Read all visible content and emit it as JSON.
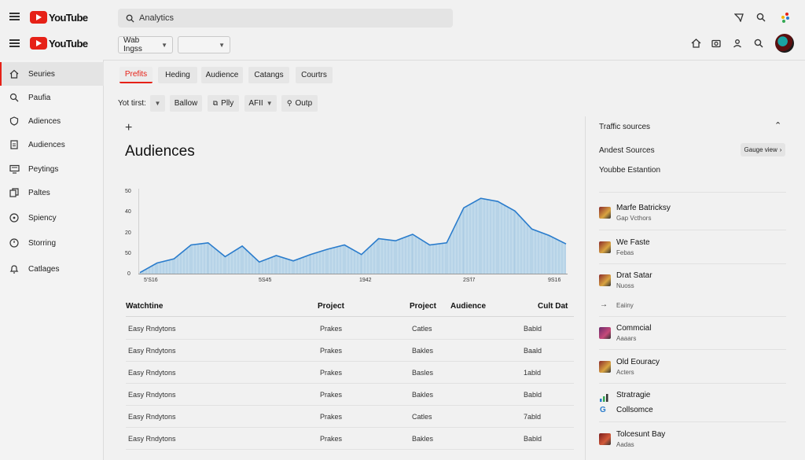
{
  "top_header": {
    "logo_text": "YouTube"
  },
  "header": {
    "logo_text": "YouTube",
    "search_placeholder": "Analytics",
    "filter1": "Wab Ingss",
    "filter2": ""
  },
  "sidebar": {
    "items": [
      {
        "label": "Seuries",
        "icon": "home-icon"
      },
      {
        "label": "Paufia",
        "icon": "search-icon"
      },
      {
        "label": "Adiences",
        "icon": "shield-icon"
      },
      {
        "label": "Audiences",
        "icon": "document-icon"
      },
      {
        "label": "Peytings",
        "icon": "monitor-icon"
      },
      {
        "label": "Paltes",
        "icon": "folders-icon"
      },
      {
        "label": "Spiency",
        "icon": "compass-icon"
      },
      {
        "label": "Storring",
        "icon": "clock-icon"
      },
      {
        "label": "Catlages",
        "icon": "bell-icon"
      }
    ]
  },
  "tabs": [
    "Prefits",
    "Heding",
    "Audience",
    "Catangs",
    "Courtrs"
  ],
  "toolbar": {
    "label": "Yot tirst:",
    "buttons": [
      "Ballow",
      "Plly",
      "AFII",
      "Outp"
    ]
  },
  "page_title": "Audiences",
  "add_symbol": "+",
  "chart_data": {
    "type": "area",
    "y_ticks": [
      "50",
      "40",
      "20",
      "50",
      "0"
    ],
    "x_labels": [
      "5'S16",
      "5S45",
      "1942",
      "2S'l7",
      "9S16"
    ],
    "values": [
      1,
      10,
      14,
      27,
      29,
      16,
      26,
      11,
      17,
      12,
      18,
      23,
      27,
      18,
      33,
      31,
      37,
      27,
      29,
      62,
      71,
      68,
      59,
      42,
      36,
      28
    ]
  },
  "table": {
    "columns": [
      "Watchtine",
      "Project",
      "Project",
      "Audience",
      "Cult Dat"
    ],
    "rows": [
      [
        "Easy Rndytons",
        "Prakes",
        "Catles",
        "Babld"
      ],
      [
        "Easy Rndytons",
        "Prakes",
        "Bakles",
        "Baald"
      ],
      [
        "Easy Rndytons",
        "Prakes",
        "Basles",
        "1abld"
      ],
      [
        "Easy Rndytons",
        "Prakes",
        "Bakles",
        "Babld"
      ],
      [
        "Easy Rndytons",
        "Prakes",
        "Catles",
        "7abld"
      ],
      [
        "Easy Rndytons",
        "Prakes",
        "Bakles",
        "Babld"
      ]
    ]
  },
  "right_panel": {
    "title": "Traffic sources",
    "subtitle": "Andest Sources",
    "gauge_button": "Gauge view",
    "subtitle2": "Youbbe Estantion",
    "items": [
      {
        "title": "Marfe Batricksy",
        "sub": "Gap Vcthors"
      },
      {
        "title": "We Faste",
        "sub": "Febas"
      },
      {
        "title": "Drat Satar",
        "sub": "Nuoss"
      },
      {
        "title": "",
        "sub": "Eaiiny"
      },
      {
        "title": "Commcial",
        "sub": "Aaaars"
      },
      {
        "title": "Old Eouracy",
        "sub": "Acters"
      },
      {
        "title": "Stratragie",
        "sub": ""
      },
      {
        "title": "Collsomce",
        "sub": ""
      },
      {
        "title": "Tolcesunt Bay",
        "sub": "Aadas"
      }
    ]
  },
  "colors": {
    "accent": "#e62117",
    "line": "#2a7ccc",
    "fill": "#b9d6ea"
  }
}
